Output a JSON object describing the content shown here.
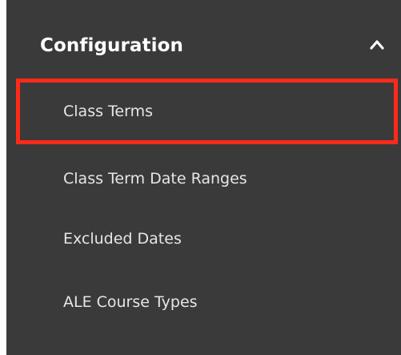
{
  "section": {
    "title": "Configuration",
    "toggle_icon": "chevron-up-icon",
    "expanded": true
  },
  "items": [
    {
      "label": "Class Terms",
      "active": true
    },
    {
      "label": "Class Term Date Ranges",
      "active": false
    },
    {
      "label": "Excluded Dates",
      "active": false
    },
    {
      "label": "ALE Course Types",
      "active": false
    }
  ],
  "colors": {
    "panel_bg": "#3a3a3a",
    "active_indicator": "#c8cf3f",
    "highlight_border": "#ff2a1a"
  }
}
